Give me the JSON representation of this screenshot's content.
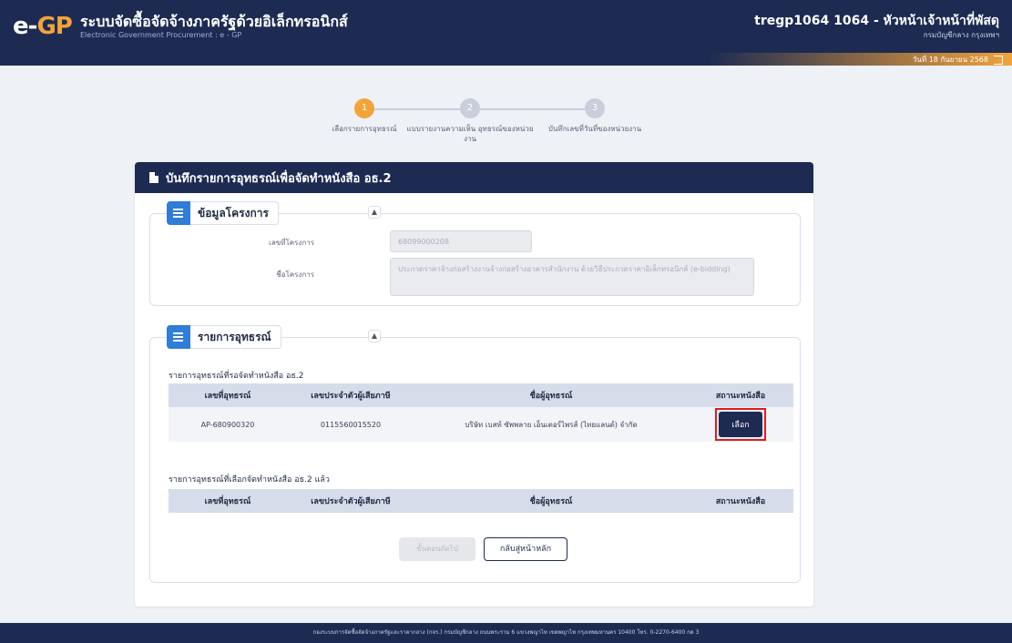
{
  "header": {
    "logo_e": "e-",
    "logo_gp": "GP",
    "title": "ระบบจัดซื้อจัดจ้างภาครัฐด้วยอิเล็กทรอนิกส์",
    "subtitle": "Electronic Government Procurement : e - GP",
    "user_name": "tregp1064 1064 - หัวหน้าเจ้าหน้าที่พัสดุ",
    "user_department": "กรมบัญชีกลาง กรุงเทพฯ",
    "date_text": "วันที่ 18 กันยายน 2568"
  },
  "stepper": {
    "steps": [
      {
        "number": "1",
        "label": "เลือกรายการอุทธรณ์"
      },
      {
        "number": "2",
        "label": "แบบรายงานความเห็น อุทธรณ์ของหน่วยงาน"
      },
      {
        "number": "3",
        "label": "บันทึกเลขที่วันที่ของหน่วยงาน"
      }
    ]
  },
  "card": {
    "title": "บันทึกรายการอุทธรณ์เพื่อจัดทำหนังสือ อธ.2",
    "project_section": {
      "title": "ข้อมูลโครงการ",
      "project_no_label": "เลขที่โครงการ",
      "project_no_value": "68099000208",
      "project_name_label": "ชื่อโครงการ",
      "project_name_value": "ประกวดราคาจ้างก่อสร้างงานจ้างก่อสร้างอาคารสำนักงาน ด้วยวิธีประกวดราคาอิเล็กทรอนิกส์ (e-bidding)"
    },
    "appeal_section": {
      "title": "รายการอุทธรณ์",
      "pending_heading": "รายการอุทธรณ์ที่รอจัดทำหนังสือ อธ.2",
      "done_heading": "รายการอุทธรณ์ที่เลือกจัดทำหนังสือ อธ.2 แล้ว",
      "columns": [
        "เลขที่อุทธรณ์",
        "เลขประจำตัวผู้เสียภาษี",
        "ชื่อผู้อุทธรณ์",
        "สถานะหนังสือ"
      ],
      "pending_rows": [
        {
          "appeal_no": "AP-680900320",
          "tax_id": "0115560015520",
          "appellant": "บริษัท เบสท์ ซัพพลาย เอ็นเตอร์ไพรส์ (ไทยแลนด์) จำกัด",
          "action": "เลือก"
        }
      ]
    },
    "buttons": {
      "next": "ขั้นตอนถัดไป",
      "back": "กลับสู่หน้าหลัก"
    }
  },
  "footer": {
    "text": "กองระบบการจัดซื้อจัดจ้างภาครัฐและราคากลาง (กจร.) กรมบัญชีกลาง ถนนพระราม 6 แขวงพญาไท เขตพญาไท กรุงเทพมหานคร 10400 โทร. 0-2270-6400 กด 3"
  }
}
